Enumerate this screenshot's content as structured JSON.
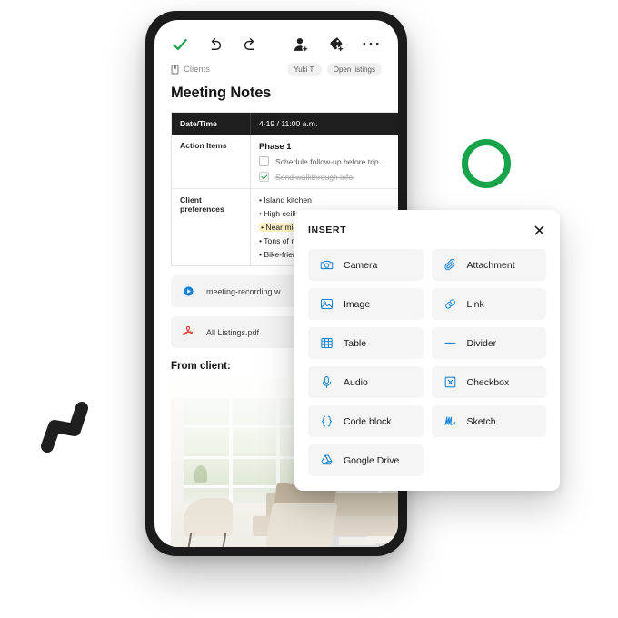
{
  "decor": {
    "ring_color": "#16a34a",
    "zigzag_color": "#1f1f1f"
  },
  "device": {
    "frame_color": "#1b1b1b"
  },
  "toolbar": {
    "done_icon": "check-icon",
    "undo_icon": "undo-icon",
    "redo_icon": "redo-icon",
    "add_person_icon": "add-person-icon",
    "add_label_icon": "add-label-icon",
    "more_icon": "more-options-icon",
    "more_label": "···",
    "accent_color": "#1aa34a"
  },
  "breadcrumb": {
    "icon": "notebook-icon",
    "label": "Clients",
    "chips": [
      {
        "label": "Yuki T."
      },
      {
        "label": "Open listings"
      }
    ]
  },
  "document": {
    "title": "Meeting Notes",
    "table": {
      "rows": [
        {
          "type": "header",
          "key": "Date/Time",
          "value": "4-19 / 11:00 a.m."
        },
        {
          "type": "tasks",
          "key": "Action Items",
          "phase": "Phase 1",
          "items": [
            {
              "label": "Schedule follow-up before trip.",
              "checked": false
            },
            {
              "label": "Send walkthrough info.",
              "checked": true
            }
          ]
        },
        {
          "type": "bullets",
          "key": "Client preferences",
          "items": [
            {
              "text": "• Island kitchen",
              "highlight": false
            },
            {
              "text": "• High ceilin",
              "highlight": false
            },
            {
              "text": "• Near midd",
              "highlight": true
            },
            {
              "text": "• Tons of na",
              "highlight": false
            },
            {
              "text": "• Bike-friend",
              "highlight": false
            }
          ]
        }
      ]
    },
    "attachments": [
      {
        "icon": "video-play-icon",
        "label": "meeting-recording.w"
      },
      {
        "icon": "pdf-icon",
        "label": "All Listings.pdf"
      }
    ],
    "from_client_label": "From client:",
    "photo_alt": "Bright living room with chaise lounge and sectional sofa"
  },
  "insert_panel": {
    "title": "INSERT",
    "close_icon": "close-icon",
    "icon_color": "#1b86d8",
    "items": [
      {
        "label": "Camera",
        "icon": "camera-icon"
      },
      {
        "label": "Attachment",
        "icon": "paperclip-icon"
      },
      {
        "label": "Image",
        "icon": "image-icon"
      },
      {
        "label": "Link",
        "icon": "link-icon"
      },
      {
        "label": "Table",
        "icon": "table-icon"
      },
      {
        "label": "Divider",
        "icon": "divider-icon"
      },
      {
        "label": "Audio",
        "icon": "microphone-icon"
      },
      {
        "label": "Checkbox",
        "icon": "checkbox-icon"
      },
      {
        "label": "Code block",
        "icon": "code-block-icon"
      },
      {
        "label": "Sketch",
        "icon": "sketch-icon"
      },
      {
        "label": "Google Drive",
        "icon": "google-drive-icon"
      }
    ]
  }
}
